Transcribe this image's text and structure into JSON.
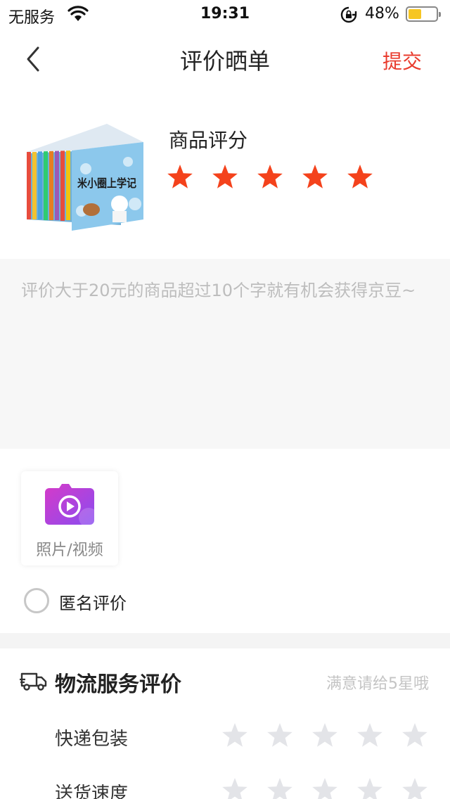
{
  "status_bar": {
    "carrier": "无服务",
    "time": "19:31",
    "battery_percent": "48%",
    "battery_level": 0.48
  },
  "nav": {
    "title": "评价晒单",
    "submit_label": "提交"
  },
  "product": {
    "rating_label": "商品评分",
    "rating": 5,
    "max_rating": 5,
    "star_color": "#f4421c",
    "cover_title": "米小圈上学记"
  },
  "comment": {
    "placeholder": "评价大于20元的商品超过10个字就有机会获得京豆~"
  },
  "media": {
    "upload_label": "照片/视频",
    "anonymous_label": "匿名评价",
    "anonymous_checked": false
  },
  "logistics": {
    "heading": "物流服务评价",
    "hint": "满意请给5星哦",
    "rows": [
      {
        "label": "快递包装",
        "rating": 0
      },
      {
        "label": "送货速度",
        "rating": 0
      }
    ],
    "empty_star_color": "#e3e4e8"
  },
  "colors": {
    "accent": "#e93b2d",
    "background_gray": "#f7f7f7"
  }
}
